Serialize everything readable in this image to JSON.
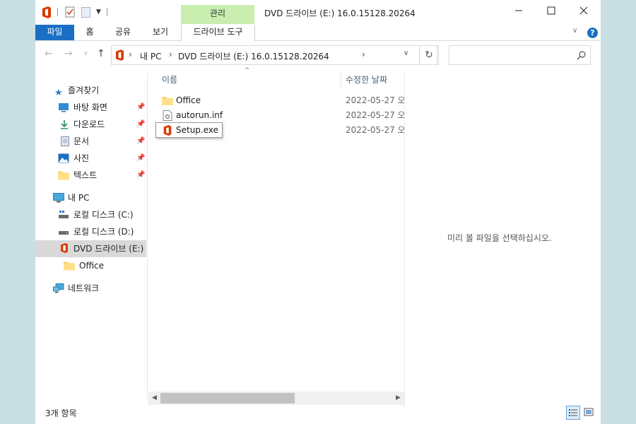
{
  "title_bar": {
    "manage_tab": "관리",
    "title": "DVD 드라이브 (E:) 16.0.15128.20264"
  },
  "ribbon": {
    "tabs": [
      "파일",
      "홈",
      "공유",
      "보기",
      "드라이브 도구"
    ]
  },
  "address": {
    "crumbs": [
      "내 PC",
      "DVD 드라이브 (E:) 16.0.15128.20264"
    ]
  },
  "nav": {
    "quick_access": "즐겨찾기",
    "quick_items": [
      "바탕 화면",
      "다운로드",
      "문서",
      "사진",
      "텍스트"
    ],
    "this_pc": "내 PC",
    "drives": [
      "로컬 디스크 (C:)",
      "로컬 디스크 (D:)",
      "DVD 드라이브 (E:)"
    ],
    "subfolder": "Office",
    "network": "네트워크"
  },
  "list": {
    "headers": {
      "name": "이름",
      "date": "수정한 날짜"
    },
    "files": [
      {
        "name": "Office",
        "date": "2022-05-27 오",
        "icon": "folder-icon"
      },
      {
        "name": "autorun.inf",
        "date": "2022-05-27 오",
        "icon": "settings-file-icon"
      },
      {
        "name": "Setup.exe",
        "date": "2022-05-27 오",
        "icon": "office-logo-icon"
      }
    ]
  },
  "preview": {
    "message": "미리 볼 파일을 선택하십시오."
  },
  "status": {
    "count": "3개 항목"
  },
  "colors": {
    "file_tab": "#1a6fc4",
    "manage_tab": "#c9eeb0",
    "office_red": "#d83b01",
    "folder": "#f8d775",
    "selected": "#d9d9d9"
  }
}
